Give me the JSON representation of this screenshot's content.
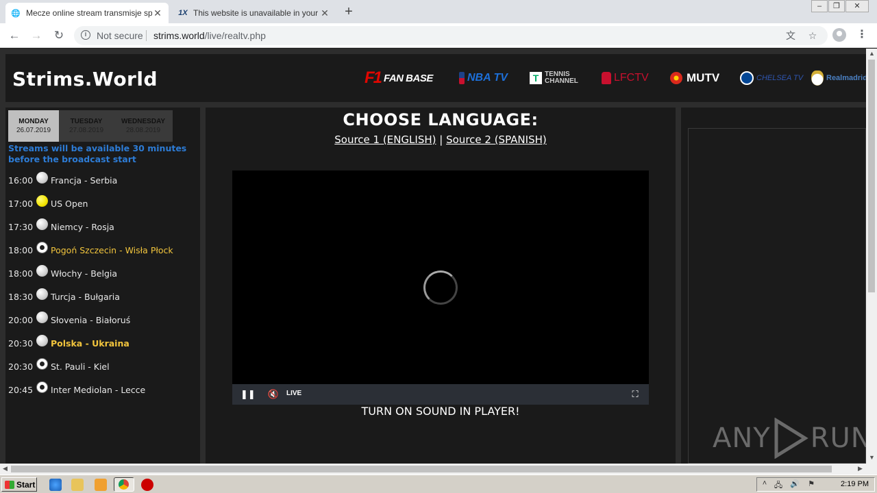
{
  "browser": {
    "tabs": [
      {
        "title": "Mecze online stream transmisje sportowe",
        "favicon": "globe-icon",
        "active": true
      },
      {
        "title": "This website is unavailable in your country",
        "favicon": "1x-icon",
        "active": false
      }
    ],
    "address": {
      "security": "Not secure",
      "host": "strims.world",
      "path": "/live/realtv.php"
    }
  },
  "site": {
    "logo": "Strims.World",
    "brands": [
      {
        "label": "FAN BASE",
        "prefix": "F1",
        "color": "#e10600"
      },
      {
        "label": "NBA TV",
        "color": "#1d6fd8"
      },
      {
        "label": "TENNIS CHANNEL",
        "color": "#cccccc"
      },
      {
        "label": "LFCTV",
        "color": "#c8102e"
      },
      {
        "label": "MUTV",
        "color": "#ffffff"
      },
      {
        "label": "CHELSEA TV",
        "color": "#1c3f94"
      },
      {
        "label": "Realmadrid",
        "color": "#4a7fc1"
      }
    ],
    "days": [
      {
        "name": "MONDAY",
        "date": "26.07.2019",
        "active": true
      },
      {
        "name": "TUESDAY",
        "date": "27.08.2019",
        "active": false
      },
      {
        "name": "WEDNESDAY",
        "date": "28.08.2019",
        "active": false
      }
    ],
    "notice": "Streams will be available 30 minutes before the broadcast start",
    "events": [
      {
        "time": "16:00",
        "ball": "white",
        "match": "Francja - Serbia",
        "highlight": "none"
      },
      {
        "time": "17:00",
        "ball": "yellow",
        "match": "US Open",
        "highlight": "none"
      },
      {
        "time": "17:30",
        "ball": "white",
        "match": "Niemcy - Rosja",
        "highlight": "none"
      },
      {
        "time": "18:00",
        "ball": "soccer",
        "match": "Pogoń Szczecin - Wisła Płock",
        "highlight": "yellow"
      },
      {
        "time": "18:00",
        "ball": "white",
        "match": "Włochy - Belgia",
        "highlight": "none"
      },
      {
        "time": "18:30",
        "ball": "white",
        "match": "Turcja - Bułgaria",
        "highlight": "none"
      },
      {
        "time": "20:00",
        "ball": "white",
        "match": "Słovenia - Białoruś",
        "highlight": "none"
      },
      {
        "time": "20:30",
        "ball": "white",
        "match": "Polska - Ukraina",
        "highlight": "bold-yellow"
      },
      {
        "time": "20:30",
        "ball": "soccer",
        "match": "St. Pauli - Kiel",
        "highlight": "none"
      },
      {
        "time": "20:45",
        "ball": "soccer",
        "match": "Inter Mediolan - Lecce",
        "highlight": "none"
      }
    ],
    "choose_language": "CHOOSE LANGUAGE:",
    "source1": "Source 1 (ENGLISH)",
    "source_sep": "|",
    "source2": "Source 2 (SPANISH)",
    "player": {
      "live_label": "LIVE"
    },
    "sound_message": "TURN ON SOUND IN PLAYER!"
  },
  "watermark": {
    "left": "ANY",
    "right": "RUN"
  },
  "taskbar": {
    "start_label": "Start",
    "clock": "2:19 PM"
  }
}
